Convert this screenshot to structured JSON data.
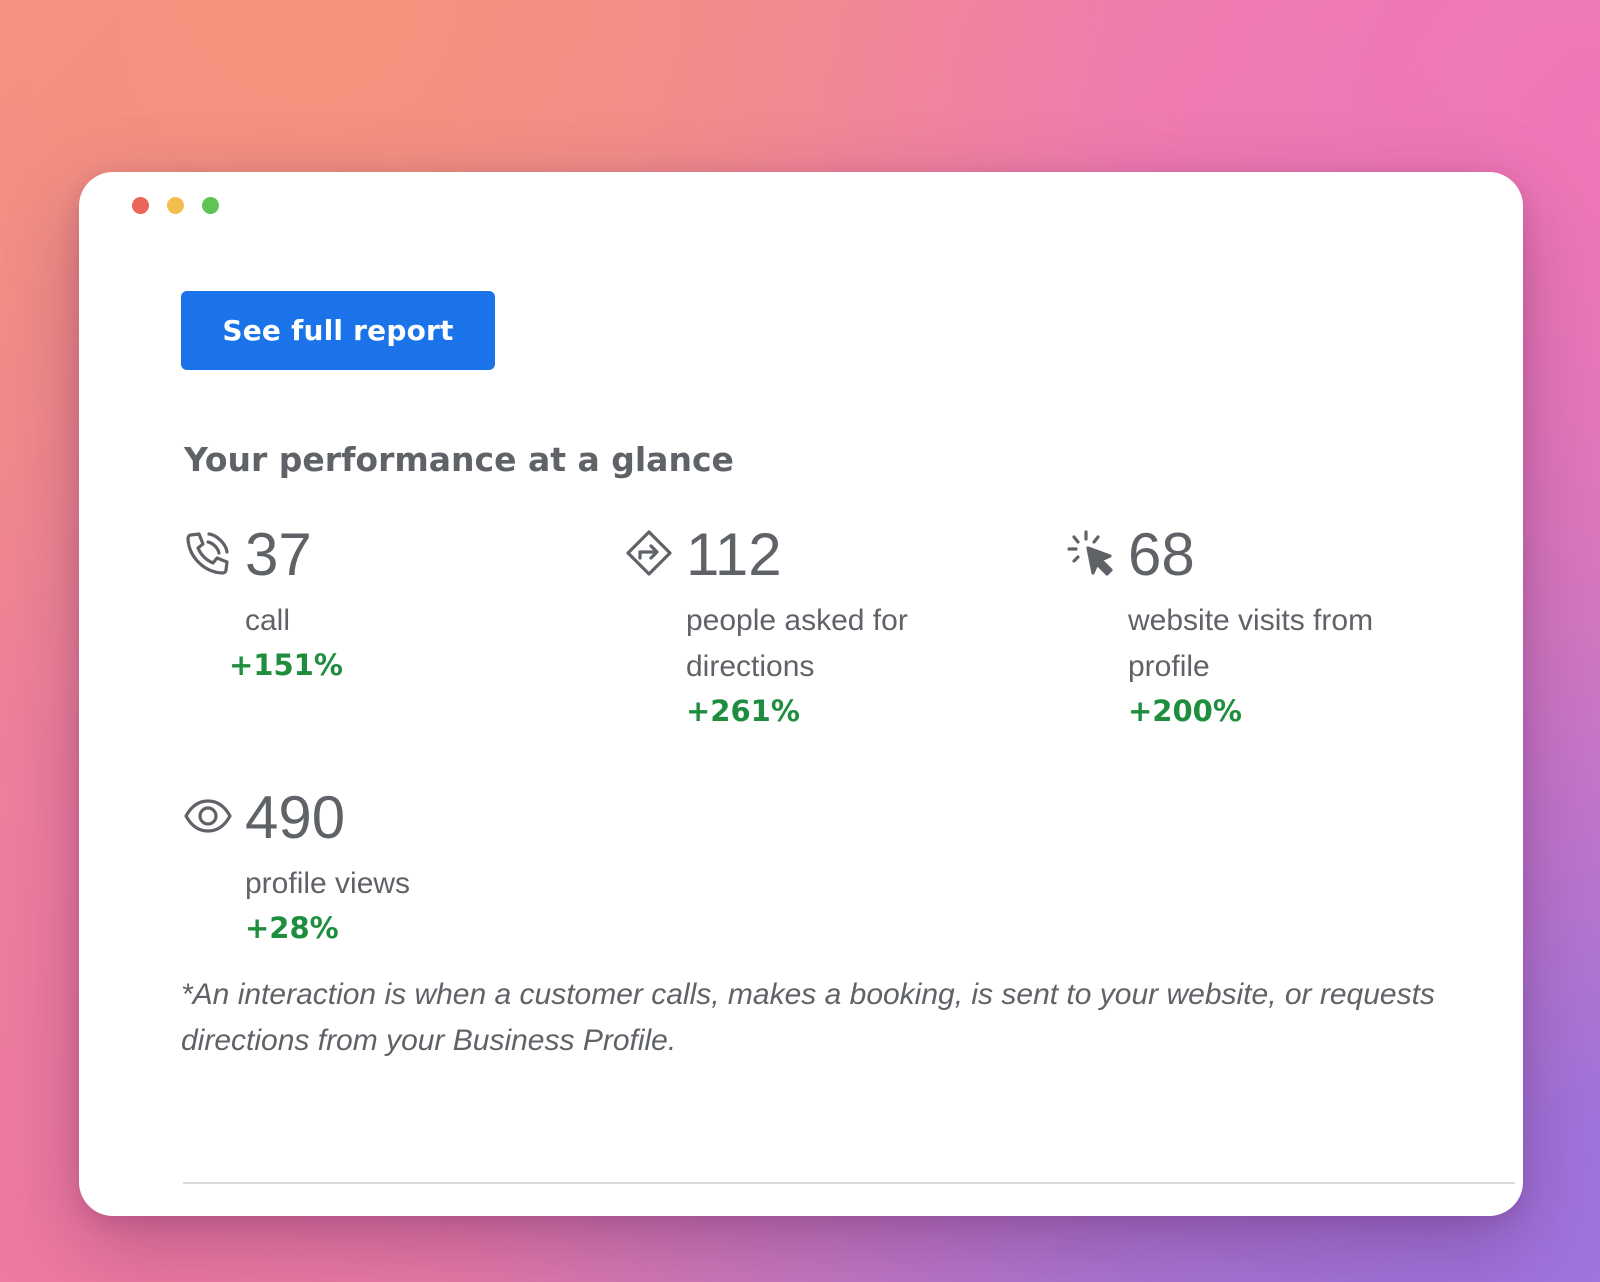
{
  "window": {
    "controls": [
      "close",
      "minimize",
      "maximize"
    ]
  },
  "report_button": {
    "label": "See full report"
  },
  "section": {
    "title": "Your performance at a glance"
  },
  "metrics": [
    {
      "icon": "phone-call-icon",
      "value": "37",
      "label": "call",
      "change": "+151%"
    },
    {
      "icon": "directions-icon",
      "value": "112",
      "label": "people asked for directions",
      "change": "+261%"
    },
    {
      "icon": "cursor-click-icon",
      "value": "68",
      "label": "website visits from profile",
      "change": "+200%"
    },
    {
      "icon": "eye-icon",
      "value": "490",
      "label": "profile views",
      "change": "+28%"
    }
  ],
  "footnote": "*An interaction is when a customer calls, makes a booking, is sent to your website, or requests directions from your Business Profile.",
  "colors": {
    "primary_button": "#1a73e8",
    "positive_change": "#1e8e3e",
    "text_gray": "#5f6368"
  }
}
